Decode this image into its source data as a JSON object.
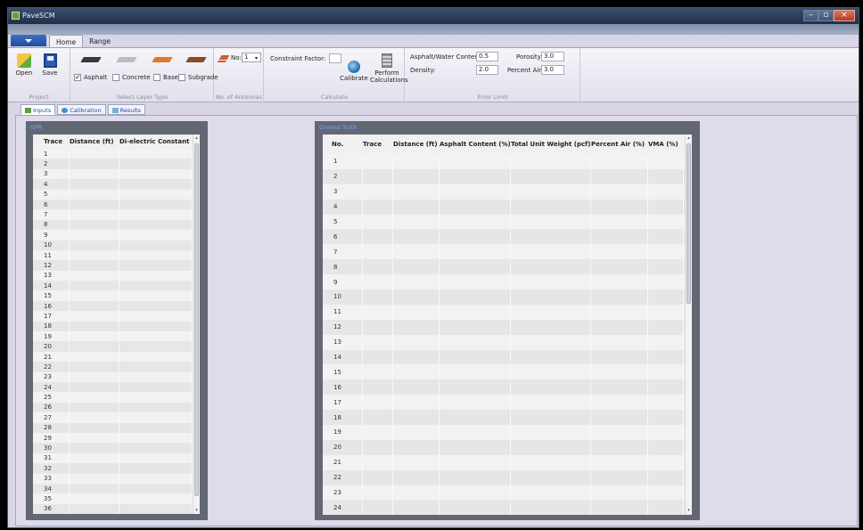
{
  "window": {
    "title": "PaveSCM",
    "controls": {
      "minimize": "–",
      "maximize": "▫",
      "close": "×"
    }
  },
  "ribbon_tabs": [
    "Home",
    "Range"
  ],
  "ribbon": {
    "project": {
      "label": "Project",
      "open": "Open",
      "save": "Save"
    },
    "layers": {
      "label": "Select Layer Type",
      "items": [
        {
          "name": "Asphalt",
          "checked": true,
          "color": "#3a3a3a"
        },
        {
          "name": "Concrete",
          "checked": false,
          "color": "#bdbdbd"
        },
        {
          "name": "Base",
          "checked": false,
          "color": "#e2792c"
        },
        {
          "name": "Subgrade",
          "checked": false,
          "color": "#8a4b22"
        }
      ]
    },
    "antennas": {
      "label": "No. of Antennas",
      "field_label": "No:",
      "value": "1"
    },
    "calculate": {
      "label": "Calculate",
      "constraint_label": "Constraint Factor:",
      "constraint_value": "",
      "calibrate": "Calibrate",
      "perform_line1": "Perform",
      "perform_line2": "Calculations"
    },
    "error_limit": {
      "label": "Error Limit",
      "aw_label": "Asphalt/Water Content:",
      "aw_value": "0.5",
      "density_label": "Density:",
      "density_value": "2.0",
      "porosity_label": "Porosity",
      "porosity_value": "3.0",
      "percent_air_label": "Percent Air",
      "percent_air_value": "3.0"
    }
  },
  "view_tabs": [
    "Inputs",
    "Calibration",
    "Results"
  ],
  "gpr_panel": {
    "title": "GPR",
    "columns": [
      "Trace",
      "Distance (ft)",
      "Di-electric Constant"
    ],
    "rows": [
      "1",
      "2",
      "3",
      "4",
      "5",
      "6",
      "7",
      "8",
      "9",
      "10",
      "11",
      "12",
      "13",
      "14",
      "15",
      "16",
      "17",
      "18",
      "19",
      "20",
      "21",
      "22",
      "23",
      "24",
      "25",
      "26",
      "27",
      "28",
      "29",
      "30",
      "31",
      "32",
      "33",
      "34",
      "35",
      "36"
    ]
  },
  "ground_truth_panel": {
    "title": "Ground Truth",
    "columns": [
      "No.",
      "Trace",
      "Distance (ft)",
      "Asphalt Content (%)",
      "Total Unit Weight (pcf)",
      "Percent Air (%)",
      "VMA (%)"
    ],
    "rows": [
      "1",
      "2",
      "3",
      "4",
      "5",
      "6",
      "7",
      "8",
      "9",
      "10",
      "11",
      "12",
      "13",
      "14",
      "15",
      "16",
      "17",
      "18",
      "19",
      "20",
      "21",
      "22",
      "23",
      "24"
    ]
  }
}
